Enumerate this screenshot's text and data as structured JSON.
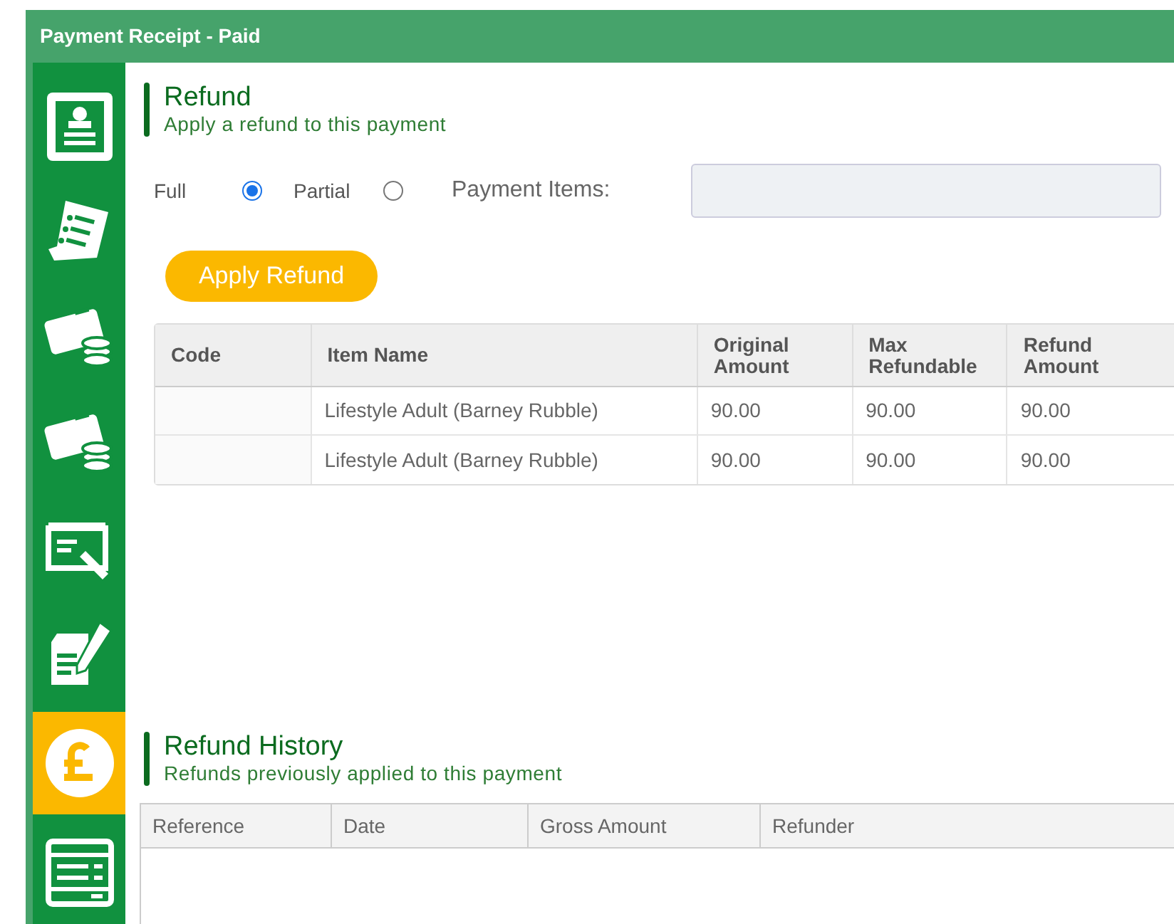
{
  "window": {
    "title": "Payment Receipt - Paid"
  },
  "sidebar": {
    "items": [
      {
        "kind": "profile",
        "selected": false
      },
      {
        "kind": "receipt",
        "selected": false
      },
      {
        "kind": "card-coins",
        "selected": false
      },
      {
        "kind": "card-coins",
        "selected": false
      },
      {
        "kind": "cheque",
        "selected": false
      },
      {
        "kind": "edit",
        "selected": false
      },
      {
        "kind": "pound",
        "selected": true
      },
      {
        "kind": "form",
        "selected": false
      }
    ]
  },
  "refund": {
    "title": "Refund",
    "subtitle": "Apply a refund to this payment",
    "options": [
      {
        "label": "Full",
        "selected": true
      },
      {
        "label": "Partial",
        "selected": false
      }
    ],
    "payment_items": {
      "label": "Payment Items:"
    },
    "apply_button": "Apply Refund",
    "table": {
      "columns": [
        "Code",
        "Item Name",
        "Original Amount",
        "Max Refundable",
        "Refund Amount"
      ],
      "rows": [
        [
          "",
          "Lifestyle Adult (Barney Rubble)",
          "90.00",
          "90.00",
          "90.00"
        ],
        [
          "",
          "Lifestyle Adult (Barney Rubble)",
          "90.00",
          "90.00",
          "90.00"
        ]
      ]
    }
  },
  "history": {
    "title": "Refund History",
    "subtitle": "Refunds previously applied to this payment",
    "columns": [
      "Reference",
      "Date",
      "Gross Amount",
      "Refunder"
    ]
  }
}
